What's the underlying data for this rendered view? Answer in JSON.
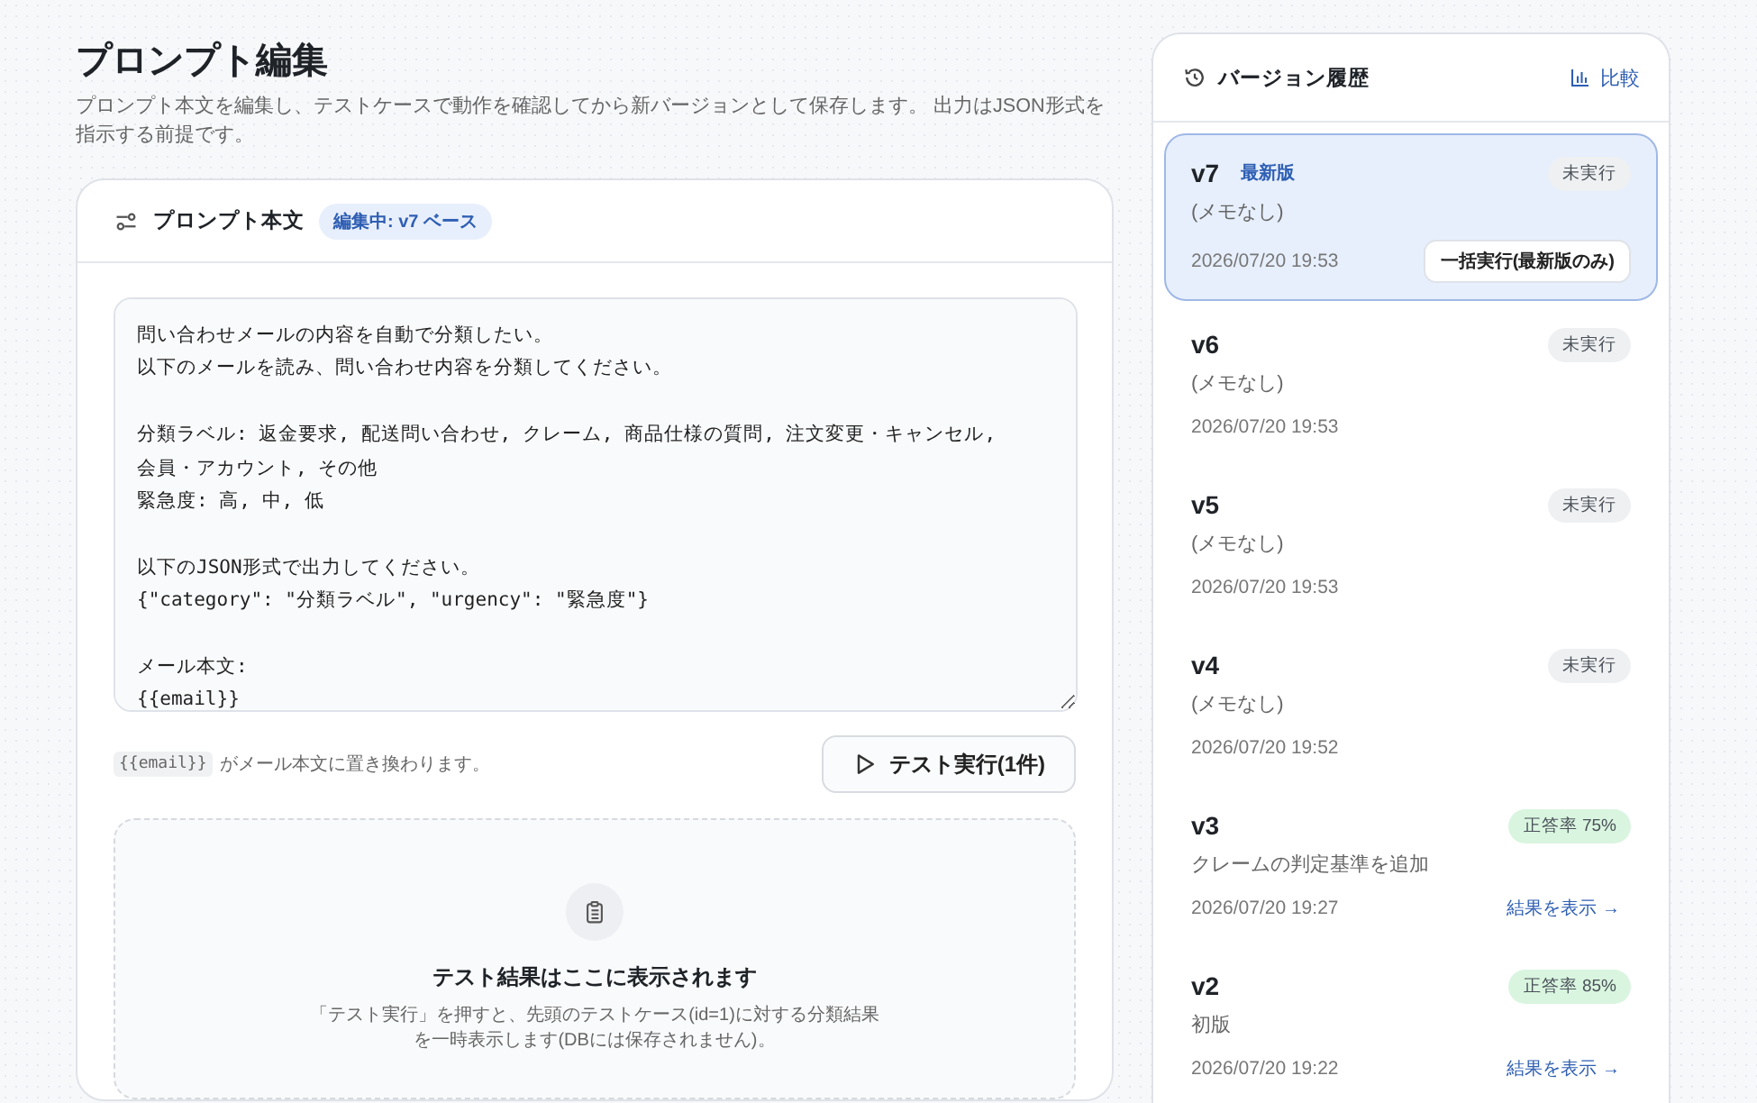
{
  "header": {
    "title": "プロンプト編集",
    "description": "プロンプト本文を編集し、テストケースで動作を確認してから新バージョンとして保存します。 出力はJSON形式を指示する前提です。"
  },
  "editor": {
    "title": "プロンプト本文",
    "badge": "編集中: v7 ベース",
    "paragraphs": [
      [
        "問い合わせメールの内容を自動で分類したい。",
        "以下のメールを読み、問い合わせ内容を分類してください。"
      ],
      [
        "分類ラベル: 返金要求, 配送問い合わせ, クレーム, 商品仕様の質問, 注文変更・キャンセル,",
        "会員・アカウント, その他",
        "緊急度: 高, 中, 低"
      ],
      [
        "以下のJSON形式で出力してください。",
        "{\"category\": \"分類ラベル\", \"urgency\": \"緊急度\"}"
      ],
      [
        "メール本文:",
        "{{email}}"
      ]
    ],
    "hint_code": "{{email}}",
    "hint_text": "がメール本文に置き換わります。",
    "run_button": "テスト実行(1件)"
  },
  "result": {
    "title": "テスト結果はここに表示されます",
    "lines": [
      "「テスト実行」を押すと、先頭のテストケース(id=1)に対する分類結果",
      "を一時表示します(DBには保存されません)。"
    ]
  },
  "history": {
    "title": "バージョン履歴",
    "compare": "比較",
    "versions": [
      {
        "name": "v7",
        "tag": "最新版",
        "badge": "未実行",
        "color": "#eef0f2",
        "memo": "(メモなし)",
        "date": "2026/07/20 19:53",
        "button": "一括実行(最新版のみ)",
        "selected": true
      },
      {
        "name": "v6",
        "badge": "未実行",
        "color": "#eef0f2",
        "memo": "(メモなし)",
        "date": "2026/07/20 19:53",
        "selected": false
      },
      {
        "name": "v5",
        "badge": "未実行",
        "color": "#eef0f2",
        "memo": "(メモなし)",
        "date": "2026/07/20 19:53",
        "selected": false
      },
      {
        "name": "v4",
        "badge": "未実行",
        "color": "#eef0f2",
        "memo": "(メモなし)",
        "date": "2026/07/20 19:52",
        "selected": false
      },
      {
        "name": "v3",
        "badge": "正答率 75%",
        "color": "#d9f5df",
        "memo": "クレームの判定基準を追加",
        "date": "2026/07/20 19:27",
        "link": "結果を表示 →",
        "selected": false
      },
      {
        "name": "v2",
        "badge": "正答率 85%",
        "color": "#d9f5df",
        "memo": "初版",
        "date": "2026/07/20 19:22",
        "link": "結果を表示 →",
        "selected": false
      }
    ]
  }
}
